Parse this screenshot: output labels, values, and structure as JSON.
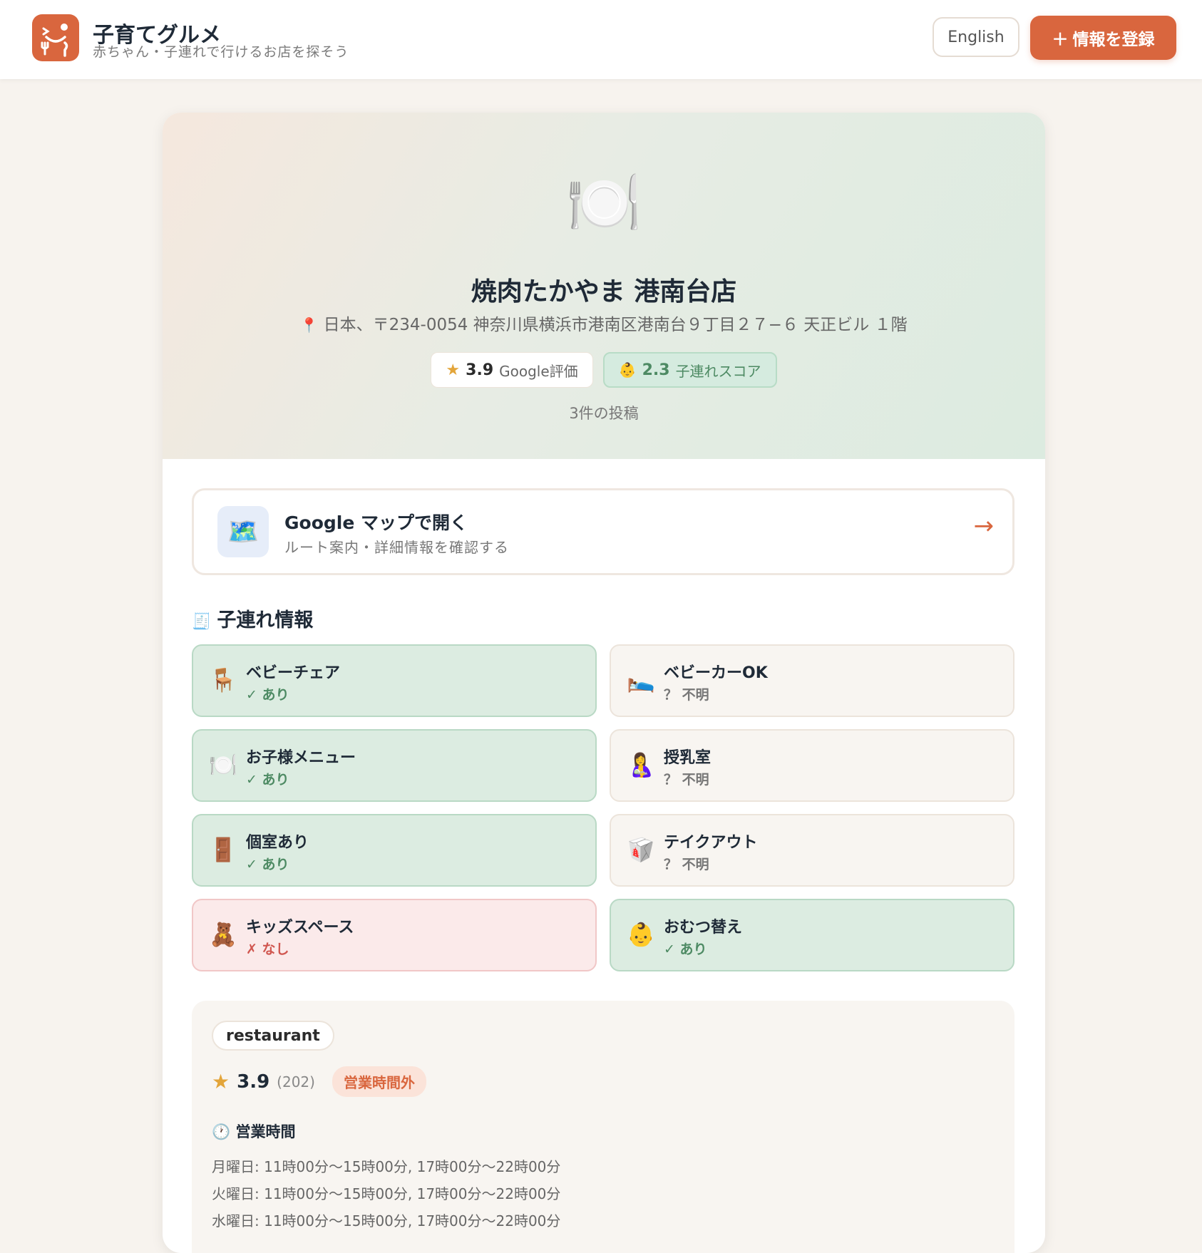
{
  "header": {
    "brand_name": "子育てグルメ",
    "brand_tagline": "赤ちゃん・子連れで行けるお店を探そう",
    "lang_button": "English",
    "register_button": "情報を登録",
    "accent_color": "#d9663e"
  },
  "shop": {
    "hero_icon": "plate-fork-knife-icon",
    "hero_emoji": "🍽️",
    "name": "焼肉たかやま 港南台店",
    "address": "日本、〒234-0054 神奈川県横浜市港南区港南台９丁目２７−６ 天正ビル １階",
    "google_rating": "3.9",
    "google_rating_label": "Google評価",
    "kid_score": "2.3",
    "kid_score_label": "子連れスコア",
    "post_count": "3件の投稿"
  },
  "map_link": {
    "title": "Google マップで開く",
    "subtitle": "ルート案内・詳細情報を確認する",
    "icon": "🗺️",
    "arrow": "→"
  },
  "kid_info": {
    "section_title": "子連れ情報",
    "section_icon": "🧾",
    "features": [
      {
        "icon": "🪑",
        "label": "ベビーチェア",
        "status": "✓ あり",
        "state": "yes"
      },
      {
        "icon": "🛌",
        "label": "ベビーカーOK",
        "status": "？ 不明",
        "state": "unknown"
      },
      {
        "icon": "🍽️",
        "label": "お子様メニュー",
        "status": "✓ あり",
        "state": "yes"
      },
      {
        "icon": "🤱",
        "label": "授乳室",
        "status": "？ 不明",
        "state": "unknown"
      },
      {
        "icon": "🚪",
        "label": "個室あり",
        "status": "✓ あり",
        "state": "yes"
      },
      {
        "icon": "🥡",
        "label": "テイクアウト",
        "status": "？ 不明",
        "state": "unknown"
      },
      {
        "icon": "🧸",
        "label": "キッズスペース",
        "status": "✗ なし",
        "state": "no"
      },
      {
        "icon": "👶",
        "label": "おむつ替え",
        "status": "✓ あり",
        "state": "yes"
      }
    ]
  },
  "place_info": {
    "category_tag": "restaurant",
    "rating": "3.9",
    "review_count": "(202)",
    "open_status": "営業時間外",
    "hours_title": "営業時間",
    "hours_icon": "🕐",
    "hours": [
      "月曜日: 11時00分～15時00分, 17時00分～22時00分",
      "火曜日: 11時00分～15時00分, 17時00分～22時00分",
      "水曜日: 11時00分～15時00分, 17時00分～22時00分"
    ]
  }
}
